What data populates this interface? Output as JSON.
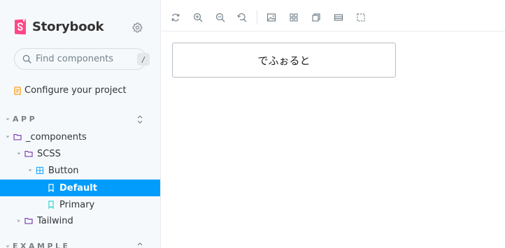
{
  "sidebar": {
    "brand": "Storybook",
    "settings_icon": "gear-icon",
    "search": {
      "placeholder": "Find components",
      "shortcut": "/"
    },
    "configure": "Configure your project",
    "groups": [
      {
        "label": "APP"
      },
      {
        "label": "EXAMPLE"
      }
    ],
    "tree": [
      {
        "label": "_components",
        "type": "folder"
      },
      {
        "label": "SCSS",
        "type": "folder"
      },
      {
        "label": "Button",
        "type": "component"
      },
      {
        "label": "Default",
        "type": "story",
        "selected": true
      },
      {
        "label": "Primary",
        "type": "story"
      },
      {
        "label": "Tailwind",
        "type": "folder"
      }
    ]
  },
  "toolbar": {
    "tools": [
      "remount-icon",
      "zoom-in-icon",
      "zoom-out-icon",
      "zoom-reset-icon",
      "background-icon",
      "grid-icon",
      "viewport-icon",
      "measure-icon",
      "outline-icon"
    ]
  },
  "canvas": {
    "button_label": "でふぉると"
  },
  "colors": {
    "accent": "#029cfd",
    "brand_pink": "#ff4785",
    "sidebar_bg": "#f6f9fc",
    "folder_icon": "#6f2cac",
    "component_icon": "#1ea7fd",
    "story_icon": "#37d5d3",
    "configure_icon": "#fc9500"
  }
}
